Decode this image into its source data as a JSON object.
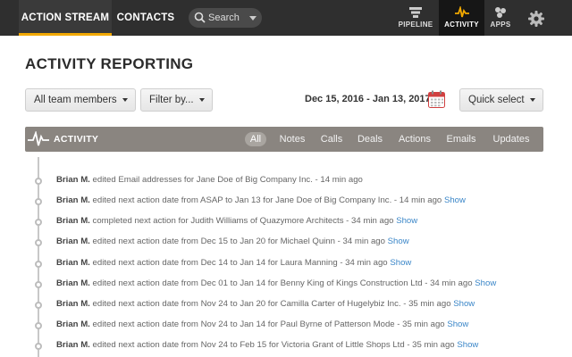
{
  "nav": {
    "action_stream": "ACTION STREAM",
    "contacts": "CONTACTS",
    "search_placeholder": "Search",
    "pipeline": "PIPELINE",
    "activity": "ACTIVITY",
    "apps": "APPS"
  },
  "page": {
    "title": "ACTIVITY REPORTING"
  },
  "filters": {
    "team": "All team members",
    "filter_by": "Filter by...",
    "date_range": "Dec 15, 2016 - Jan 13, 2017",
    "quick_select": "Quick select"
  },
  "activity_bar": {
    "title": "ACTIVITY",
    "tabs": [
      "All",
      "Notes",
      "Calls",
      "Deals",
      "Actions",
      "Emails",
      "Updates"
    ],
    "active_tab": "All"
  },
  "feed": [
    {
      "user": "Brian M.",
      "text": " edited Email addresses for Jane Doe of Big Company Inc. - 14 min ago",
      "link": ""
    },
    {
      "user": "Brian M.",
      "text": " edited next action date from ASAP to Jan 13 for Jane Doe of Big Company Inc. - 14 min ago",
      "link": "Show"
    },
    {
      "user": "Brian M.",
      "text": " completed next action for Judith Williams of Quazymore Architects - 34 min ago",
      "link": "Show"
    },
    {
      "user": "Brian M.",
      "text": " edited next action date from Dec 15 to Jan 20 for Michael Quinn - 34 min ago",
      "link": "Show"
    },
    {
      "user": "Brian M.",
      "text": " edited next action date from Dec 14 to Jan 14 for Laura Manning - 34 min ago",
      "link": "Show"
    },
    {
      "user": "Brian M.",
      "text": " edited next action date from Dec 01 to Jan 14 for Benny King of Kings Construction Ltd - 34 min ago",
      "link": "Show"
    },
    {
      "user": "Brian M.",
      "text": " edited next action date from Nov 24 to Jan 20 for Camilla Carter of Hugelybiz Inc. - 35 min ago",
      "link": "Show"
    },
    {
      "user": "Brian M.",
      "text": " edited next action date from Nov 24 to Jan 14 for Paul Byrne of Patterson Mode - 35 min ago",
      "link": "Show"
    },
    {
      "user": "Brian M.",
      "text": " edited next action date from Nov 24 to Feb 15 for Victoria Grant of Little Shops Ltd - 35 min ago",
      "link": "Show"
    }
  ],
  "colors": {
    "accent": "#f2a900",
    "link": "#3a86c8",
    "nav_bg": "#2f2f2f",
    "bar_bg": "#8a8580"
  }
}
